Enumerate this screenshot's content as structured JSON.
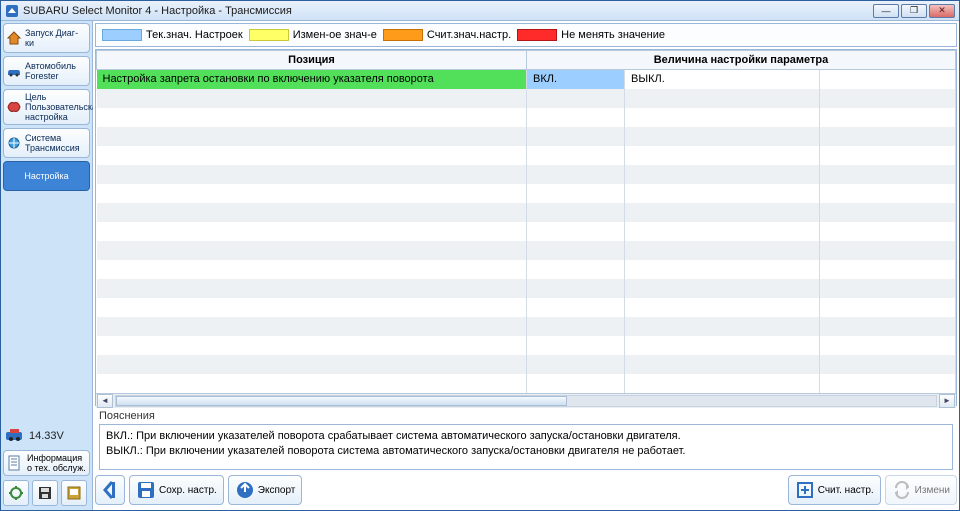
{
  "window": {
    "title": "SUBARU Select Monitor 4 - Настройка - Трансмиссия"
  },
  "sidebar": {
    "items": [
      {
        "id": "home",
        "label": "Запуск Диаг-ки",
        "active": false
      },
      {
        "id": "vehicle",
        "label": "Автомобиль Forester",
        "active": false
      },
      {
        "id": "target",
        "label": "Цель Пользовательская настройка",
        "active": false
      },
      {
        "id": "system",
        "label": "Система Трансмиссия",
        "active": false
      },
      {
        "id": "setup",
        "label": "Настройка",
        "active": true
      }
    ],
    "voltage": "14.33V",
    "info_label": "Информация о тех. обслуж."
  },
  "legend": {
    "current": "Тек.знач. Настроек",
    "changed": "Измен-ое знач-е",
    "read": "Счит.знач.настр.",
    "nochange": "Не менять значение"
  },
  "table": {
    "col_position": "Позиция",
    "col_value": "Величина настройки параметра",
    "rows": [
      {
        "position": "Настройка запрета остановки по включению указателя поворота",
        "val_a": "ВКЛ.",
        "val_b": "ВЫКЛ."
      }
    ]
  },
  "explain": {
    "label": "Пояснения",
    "line1": "ВКЛ.: При включении указателей поворота срабатывает система автоматического запуска/остановки двигателя.",
    "line2": "ВЫКЛ.: При включении указателей поворота система автоматического запуска/остановки двигателя не работает."
  },
  "footer": {
    "save": "Сохр. настр.",
    "export": "Экспорт",
    "read": "Счит. настр.",
    "change": "Измени"
  }
}
